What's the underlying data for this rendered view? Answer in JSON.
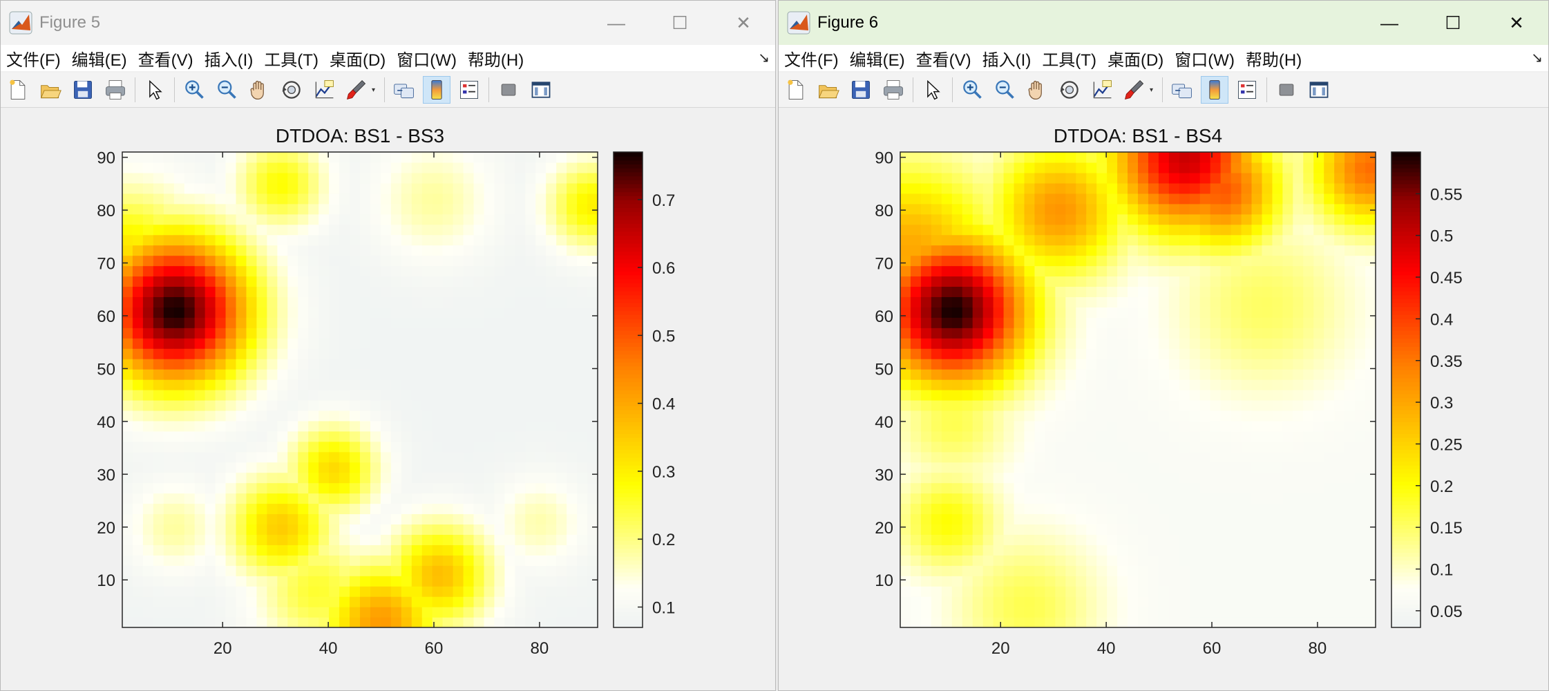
{
  "menus": [
    "文件(F)",
    "编辑(E)",
    "查看(V)",
    "插入(I)",
    "工具(T)",
    "桌面(D)",
    "窗口(W)",
    "帮助(H)"
  ],
  "toolbar_icons": [
    "new-figure-icon",
    "open-file-icon",
    "save-icon",
    "print-icon",
    "pointer-icon",
    "zoom-in-icon",
    "zoom-out-icon",
    "pan-hand-icon",
    "rotate-3d-icon",
    "data-cursor-icon",
    "brush-icon",
    "link-plot-icon",
    "colorbar-icon",
    "legend-icon",
    "hide-plot-tools-icon",
    "show-plot-tools-icon"
  ],
  "controls": {
    "minimize": "—",
    "maximize": "☐",
    "close": "✕",
    "menu_arrow": "↘"
  },
  "colors": {
    "heat_low": "#eef2f2",
    "heat_mid": "#ffff00",
    "heat_orange": "#ff8000",
    "heat_red": "#ff0000",
    "heat_high": "#1a0000",
    "active_tool": "#cfe6f8"
  },
  "figure5": {
    "window_title": "Figure 5",
    "chart_data": {
      "type": "heatmap",
      "title": "DTDOA: BS1 - BS3",
      "xlim": [
        1,
        91
      ],
      "ylim": [
        1,
        91
      ],
      "xticks": [
        20,
        40,
        60,
        80
      ],
      "yticks": [
        10,
        20,
        30,
        40,
        50,
        60,
        70,
        80,
        90
      ],
      "colorbar": {
        "min": 0.07,
        "max": 0.77,
        "ticks": [
          0.1,
          0.2,
          0.3,
          0.4,
          0.5,
          0.6,
          0.7
        ],
        "colormap": "hot-reversed"
      },
      "background_level": 0.08,
      "hotspots": [
        {
          "x": 11,
          "y": 61,
          "value": 0.77,
          "spread": 10
        },
        {
          "x": 2,
          "y": 70,
          "value": 0.33,
          "spread": 10
        },
        {
          "x": 31,
          "y": 85,
          "value": 0.28,
          "spread": 6
        },
        {
          "x": 31,
          "y": 20,
          "value": 0.35,
          "spread": 7
        },
        {
          "x": 41,
          "y": 31,
          "value": 0.33,
          "spread": 6
        },
        {
          "x": 61,
          "y": 11,
          "value": 0.37,
          "spread": 7
        },
        {
          "x": 50,
          "y": 2,
          "value": 0.42,
          "spread": 8
        },
        {
          "x": 38,
          "y": 8,
          "value": 0.25,
          "spread": 8
        },
        {
          "x": 90,
          "y": 81,
          "value": 0.3,
          "spread": 6
        },
        {
          "x": 60,
          "y": 82,
          "value": 0.18,
          "spread": 8
        },
        {
          "x": 11,
          "y": 20,
          "value": 0.18,
          "spread": 6
        },
        {
          "x": 80,
          "y": 21,
          "value": 0.17,
          "spread": 6
        }
      ]
    }
  },
  "figure6": {
    "window_title": "Figure 6",
    "chart_data": {
      "type": "heatmap",
      "title": "DTDOA: BS1 - BS4",
      "xlim": [
        1,
        91
      ],
      "ylim": [
        1,
        91
      ],
      "xticks": [
        20,
        40,
        60,
        80
      ],
      "yticks": [
        10,
        20,
        30,
        40,
        50,
        60,
        70,
        80,
        90
      ],
      "colorbar": {
        "min": 0.03,
        "max": 0.6,
        "ticks": [
          0.05,
          0.1,
          0.15,
          0.2,
          0.25,
          0.3,
          0.35,
          0.4,
          0.45,
          0.5,
          0.55
        ],
        "colormap": "hot-reversed"
      },
      "background_level": 0.06,
      "hotspots": [
        {
          "x": 11,
          "y": 61,
          "value": 0.6,
          "spread": 10
        },
        {
          "x": 3,
          "y": 72,
          "value": 0.3,
          "spread": 12
        },
        {
          "x": 31,
          "y": 80,
          "value": 0.32,
          "spread": 9
        },
        {
          "x": 55,
          "y": 90,
          "value": 0.5,
          "spread": 10
        },
        {
          "x": 62,
          "y": 84,
          "value": 0.38,
          "spread": 8
        },
        {
          "x": 90,
          "y": 88,
          "value": 0.36,
          "spread": 8
        },
        {
          "x": 10,
          "y": 21,
          "value": 0.2,
          "spread": 7
        },
        {
          "x": 25,
          "y": 5,
          "value": 0.16,
          "spread": 10
        },
        {
          "x": 70,
          "y": 62,
          "value": 0.15,
          "spread": 12
        },
        {
          "x": 11,
          "y": 40,
          "value": 0.16,
          "spread": 8
        }
      ]
    }
  }
}
